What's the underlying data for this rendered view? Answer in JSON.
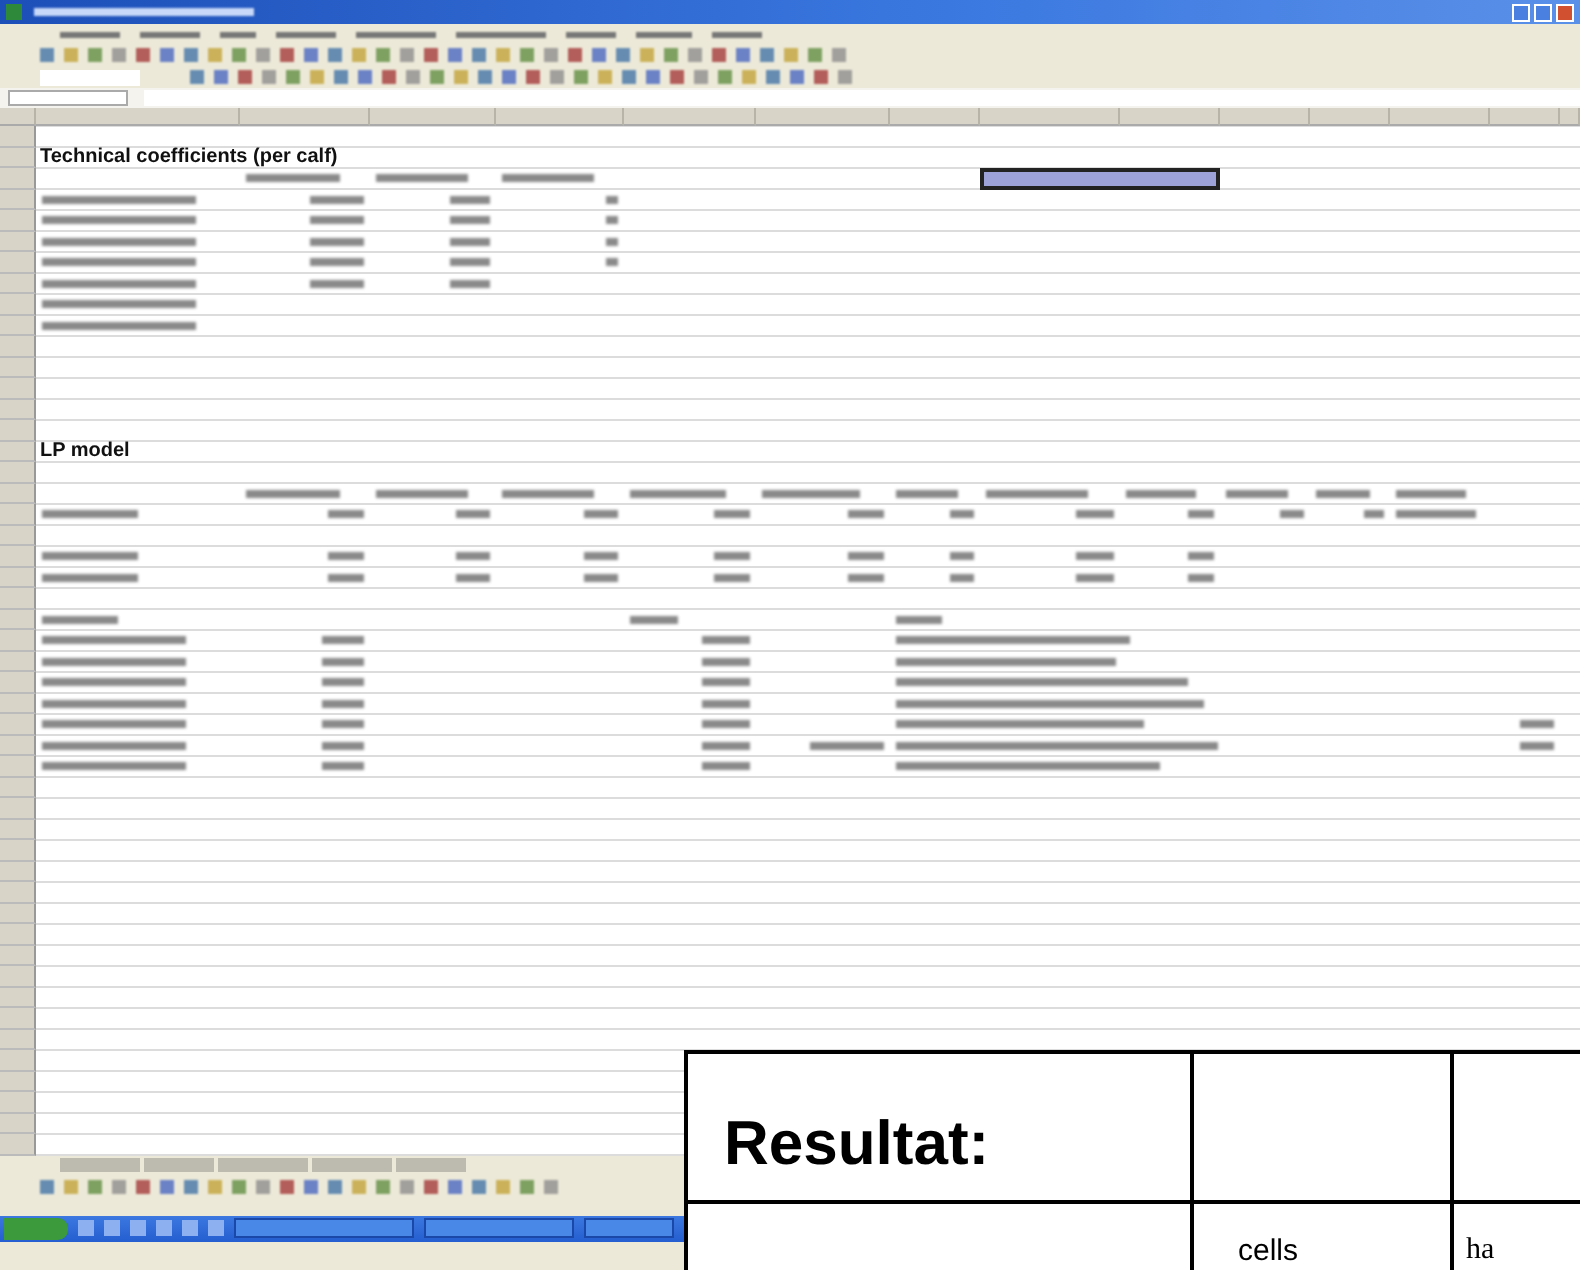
{
  "sheet": {
    "headings": [
      {
        "text": "Technical coefficients (per calf)"
      },
      {
        "text": "LP model"
      }
    ]
  },
  "result_table": {
    "title": "Resultat:",
    "units": [
      {
        "text": "cells",
        "kind": "sans"
      },
      {
        "text": "ha",
        "kind": "serif"
      }
    ]
  }
}
